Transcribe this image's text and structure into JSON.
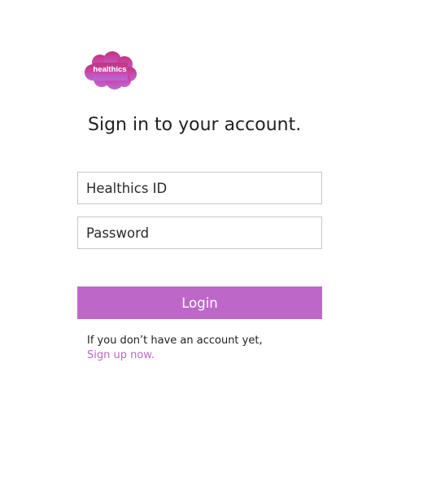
{
  "logo": {
    "text": "healthics",
    "colors": {
      "top": "#c2347e",
      "middle": "#c94bb0",
      "bottom": "#b86ad6"
    }
  },
  "page": {
    "title": "Sign in to your account."
  },
  "form": {
    "id_placeholder": "Healthics ID",
    "id_value": "",
    "password_placeholder": "Password",
    "password_value": "",
    "login_label": "Login"
  },
  "signup": {
    "prompt": "If you don’t have an account yet,",
    "link_label": "Sign up now."
  },
  "theme": {
    "accent": "#bd68c8",
    "border": "#c8c8c8",
    "text": "#222222"
  }
}
